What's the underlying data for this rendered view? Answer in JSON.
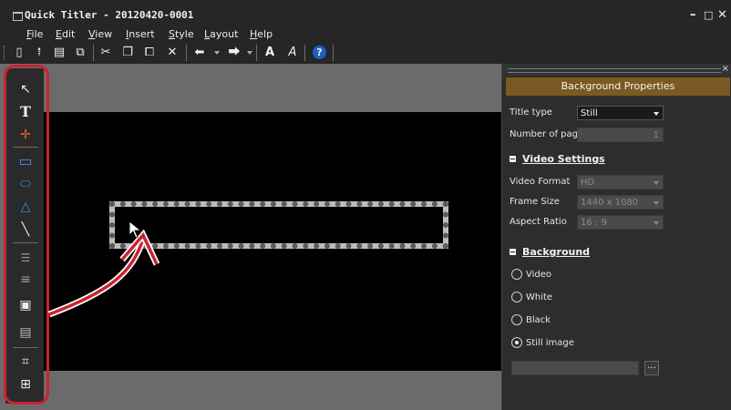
{
  "window": {
    "title": "Quick Titler - 20120420-0001",
    "min_symbol": "–",
    "max_symbol": "□",
    "close_symbol": "✕"
  },
  "menu": [
    {
      "label": "File",
      "mnemonic": "F",
      "rest": "ile"
    },
    {
      "label": "Edit",
      "mnemonic": "E",
      "rest": "dit"
    },
    {
      "label": "View",
      "mnemonic": "V",
      "rest": "iew"
    },
    {
      "label": "Insert",
      "mnemonic": "I",
      "rest": "nsert"
    },
    {
      "label": "Style",
      "mnemonic": "S",
      "rest": "tyle"
    },
    {
      "label": "Layout",
      "mnemonic": "L",
      "rest": "ayout"
    },
    {
      "label": "Help",
      "mnemonic": "H",
      "rest": "elp"
    }
  ],
  "toolbar": {
    "new_icon": "new-file-icon",
    "new_glyph": "▯",
    "open_icon": "open-icon",
    "open_glyph": "⭫",
    "save_icon": "save-icon",
    "save_glyph": "▤",
    "saveas_icon": "save-as-icon",
    "saveas_glyph": "⧉",
    "cut_glyph": "✂",
    "copy_glyph": "❐",
    "paste_glyph": "⧠",
    "delete_glyph": "✕",
    "undo_glyph": "⬅",
    "redo_glyph": "⮕",
    "font_glyph": "A",
    "style_glyph": "A",
    "help_glyph": "?"
  },
  "tools": {
    "select_glyph": "↖",
    "text_glyph": "T",
    "move_glyph": "✛",
    "rect_glyph": "▭",
    "ellipse_glyph": "⬭",
    "triangle_glyph": "△",
    "line_glyph": "╲",
    "align_glyph": "☰",
    "distribute_glyph": "≡",
    "center_glyph": "▣",
    "order_glyph": "▤",
    "grid_glyph": "⌗",
    "safe_area_glyph": "⊞"
  },
  "panel": {
    "header": "Background Properties",
    "title_type_label": "Title type",
    "title_type_value": "Still",
    "pages_label": "Number of pages",
    "pages_value": "1",
    "video_settings_label": "Video Settings",
    "video_format_label": "Video Format",
    "video_format_value": "HD",
    "frame_size_label": "Frame Size",
    "frame_size_value": "1440 x 1080",
    "aspect_ratio_label": "Aspect Ratio",
    "aspect_ratio_value": "16 : 9",
    "background_label": "Background",
    "options": [
      {
        "label": "Video",
        "checked": false
      },
      {
        "label": "White",
        "checked": false
      },
      {
        "label": "Black",
        "checked": false
      },
      {
        "label": "Still image",
        "checked": true
      }
    ],
    "image_path": "",
    "browse_label": "..."
  },
  "colors": {
    "accent_header": "#7a5a22",
    "highlight": "#cc2233",
    "canvas": "#000000",
    "workspace": "#6b6b6b"
  }
}
